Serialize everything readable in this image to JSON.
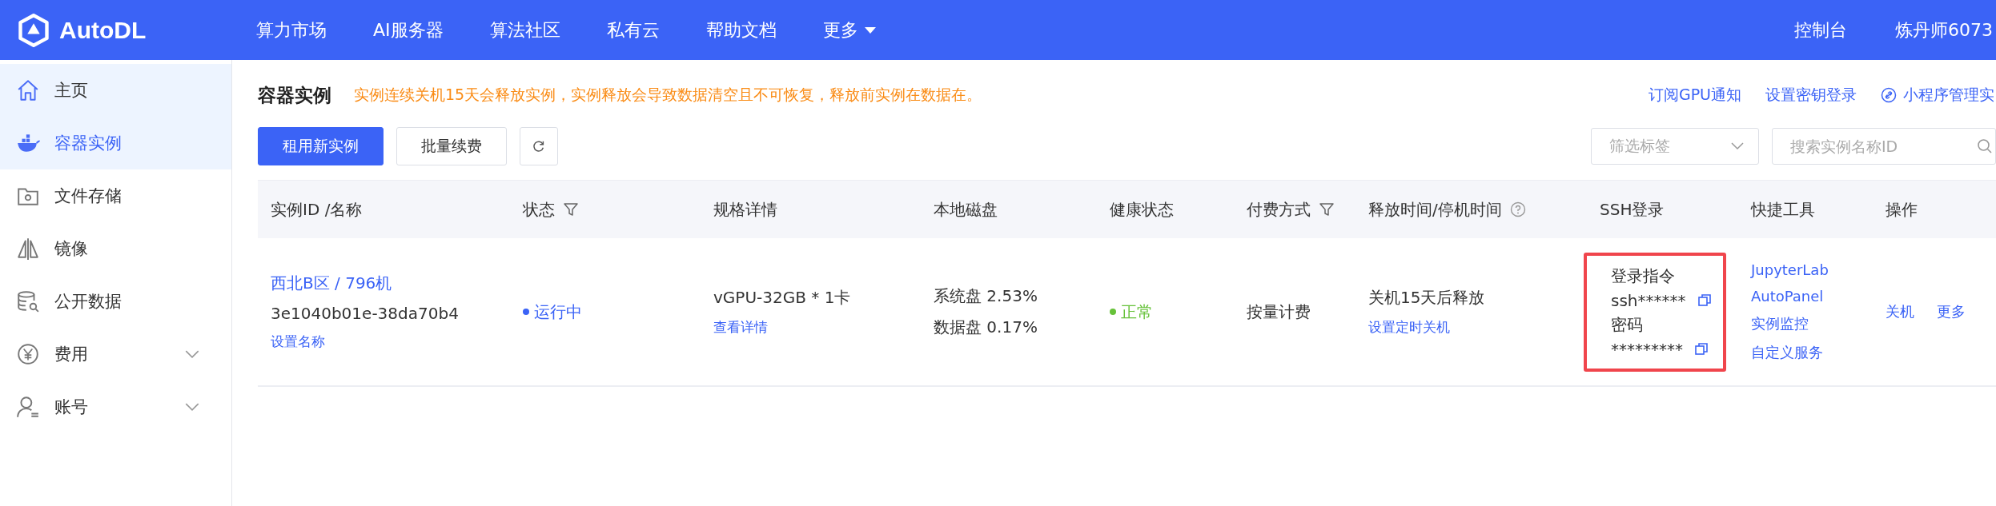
{
  "header": {
    "logo": "AutoDL",
    "nav": [
      {
        "label": "算力市场",
        "dropdown": false
      },
      {
        "label": "AI服务器",
        "dropdown": false
      },
      {
        "label": "算法社区",
        "dropdown": false
      },
      {
        "label": "私有云",
        "dropdown": false
      },
      {
        "label": "帮助文档",
        "dropdown": false
      },
      {
        "label": "更多",
        "dropdown": true
      }
    ],
    "console": "控制台",
    "user": "炼丹师6073"
  },
  "sidebar": {
    "items": [
      {
        "label": "主页",
        "selected": false,
        "hovered": true,
        "expandable": false
      },
      {
        "label": "容器实例",
        "selected": true,
        "hovered": false,
        "expandable": false
      },
      {
        "label": "文件存储",
        "selected": false,
        "hovered": false,
        "expandable": false
      },
      {
        "label": "镜像",
        "selected": false,
        "hovered": false,
        "expandable": false
      },
      {
        "label": "公开数据",
        "selected": false,
        "hovered": false,
        "expandable": false
      },
      {
        "label": "费用",
        "selected": false,
        "hovered": false,
        "expandable": true
      },
      {
        "label": "账号",
        "selected": false,
        "hovered": false,
        "expandable": true
      }
    ]
  },
  "page": {
    "title": "容器实例",
    "notice": "实例连续关机15天会释放实例，实例释放会导致数据清空且不可恢复，释放前实例在数据在。",
    "links": [
      {
        "label": "订阅GPU通知",
        "icon": false
      },
      {
        "label": "设置密钥登录",
        "icon": false
      },
      {
        "label": "小程序管理实",
        "icon": true
      }
    ],
    "buttons": [
      {
        "label": "租用新实例",
        "kind": "primary"
      },
      {
        "label": "批量续费",
        "kind": "plain"
      }
    ],
    "filter": {
      "placeholder": "筛选标签"
    },
    "search": {
      "placeholder": "搜索实例名称ID"
    }
  },
  "table": {
    "columns": [
      {
        "label": "实例ID /名称",
        "filter": false,
        "help": false
      },
      {
        "label": "状态",
        "filter": true,
        "help": false
      },
      {
        "label": "规格详情",
        "filter": false,
        "help": false
      },
      {
        "label": "本地磁盘",
        "filter": false,
        "help": false
      },
      {
        "label": "健康状态",
        "filter": false,
        "help": false
      },
      {
        "label": "付费方式",
        "filter": true,
        "help": false
      },
      {
        "label": "释放时间/停机时间",
        "filter": false,
        "help": true
      },
      {
        "label": "SSH登录",
        "filter": false,
        "help": false
      },
      {
        "label": "快捷工具",
        "filter": false,
        "help": false
      },
      {
        "label": "操作",
        "filter": false,
        "help": false
      }
    ],
    "rows": [
      {
        "name": "西北B区 / 796机",
        "id": "3e1040b01e-38da70b4",
        "rename": "设置名称",
        "status": {
          "text": "运行中",
          "color": "#3b63f6"
        },
        "spec": "vGPU-32GB * 1卡",
        "spec_link": "查看详情",
        "disks": [
          "系统盘 2.53%",
          "数据盘 0.17%"
        ],
        "health": {
          "text": "正常",
          "color": "#67c23a"
        },
        "billing": "按量计费",
        "release": "关机15天后释放",
        "release_link": "设置定时关机",
        "ssh": {
          "highlighted": true,
          "command_label": "登录指令",
          "command": "ssh******",
          "password_label": "密码",
          "password": "*********"
        },
        "tools": [
          "JupyterLab",
          "AutoPanel",
          "实例监控",
          "自定义服务"
        ],
        "actions": [
          "关机",
          "更多"
        ]
      }
    ]
  }
}
